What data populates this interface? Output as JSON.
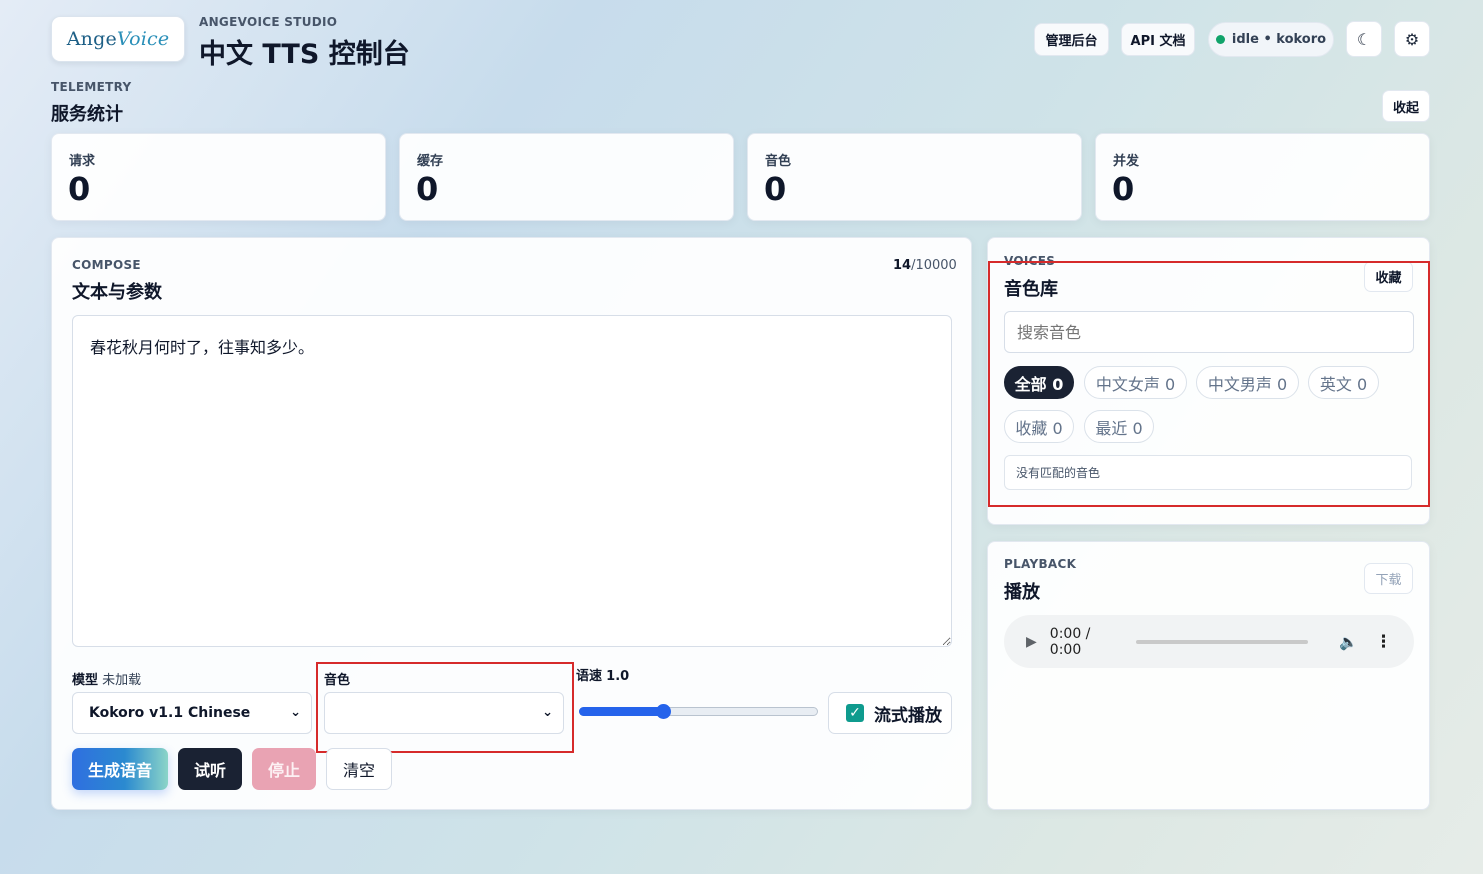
{
  "header": {
    "logo_part1": "Ange",
    "logo_part2": "Voice",
    "eyebrow": "ANGEVOICE STUDIO",
    "title": "中文 TTS 控制台",
    "admin_button": "管理后台",
    "api_button": "API 文档",
    "status_text": "idle • kokoro",
    "theme_icon": "moon-icon",
    "settings_icon": "gear-icon",
    "status_dot_color": "#10a36a"
  },
  "telemetry": {
    "eyebrow": "TELEMETRY",
    "title": "服务统计",
    "collapse_button": "收起",
    "stats": [
      {
        "label": "请求",
        "value": "0"
      },
      {
        "label": "缓存",
        "value": "0"
      },
      {
        "label": "音色",
        "value": "0"
      },
      {
        "label": "并发",
        "value": "0"
      }
    ]
  },
  "compose": {
    "eyebrow": "COMPOSE",
    "title": "文本与参数",
    "char_count": "14",
    "char_max": "/10000",
    "text": "春花秋月何时了，往事知多少。",
    "model_label": "模型",
    "model_status": "未加载",
    "model_value": "Kokoro v1.1 Chinese",
    "voice_label": "音色",
    "voice_value": "",
    "speed_label": "语速",
    "speed_value": "1.0",
    "speed_fraction": 0.35,
    "stream_label": "流式播放",
    "stream_checked": true,
    "buttons": {
      "generate": "生成语音",
      "preview": "试听",
      "stop": "停止",
      "clear": "清空"
    }
  },
  "voices": {
    "eyebrow": "VOICES",
    "title": "音色库",
    "favorite_button": "收藏",
    "search_placeholder": "搜索音色",
    "chips": [
      "全部 0",
      "中文女声 0",
      "中文男声 0",
      "英文 0",
      "收藏 0",
      "最近 0"
    ],
    "empty_text": "没有匹配的音色"
  },
  "playback": {
    "eyebrow": "PLAYBACK",
    "title": "播放",
    "download_button": "下载",
    "time": "0:00 / 0:00"
  },
  "colors": {
    "accent": "#2563eb",
    "dark": "#1a2233",
    "stop": "#e9a3b3",
    "highlight": "#d62b2b"
  }
}
